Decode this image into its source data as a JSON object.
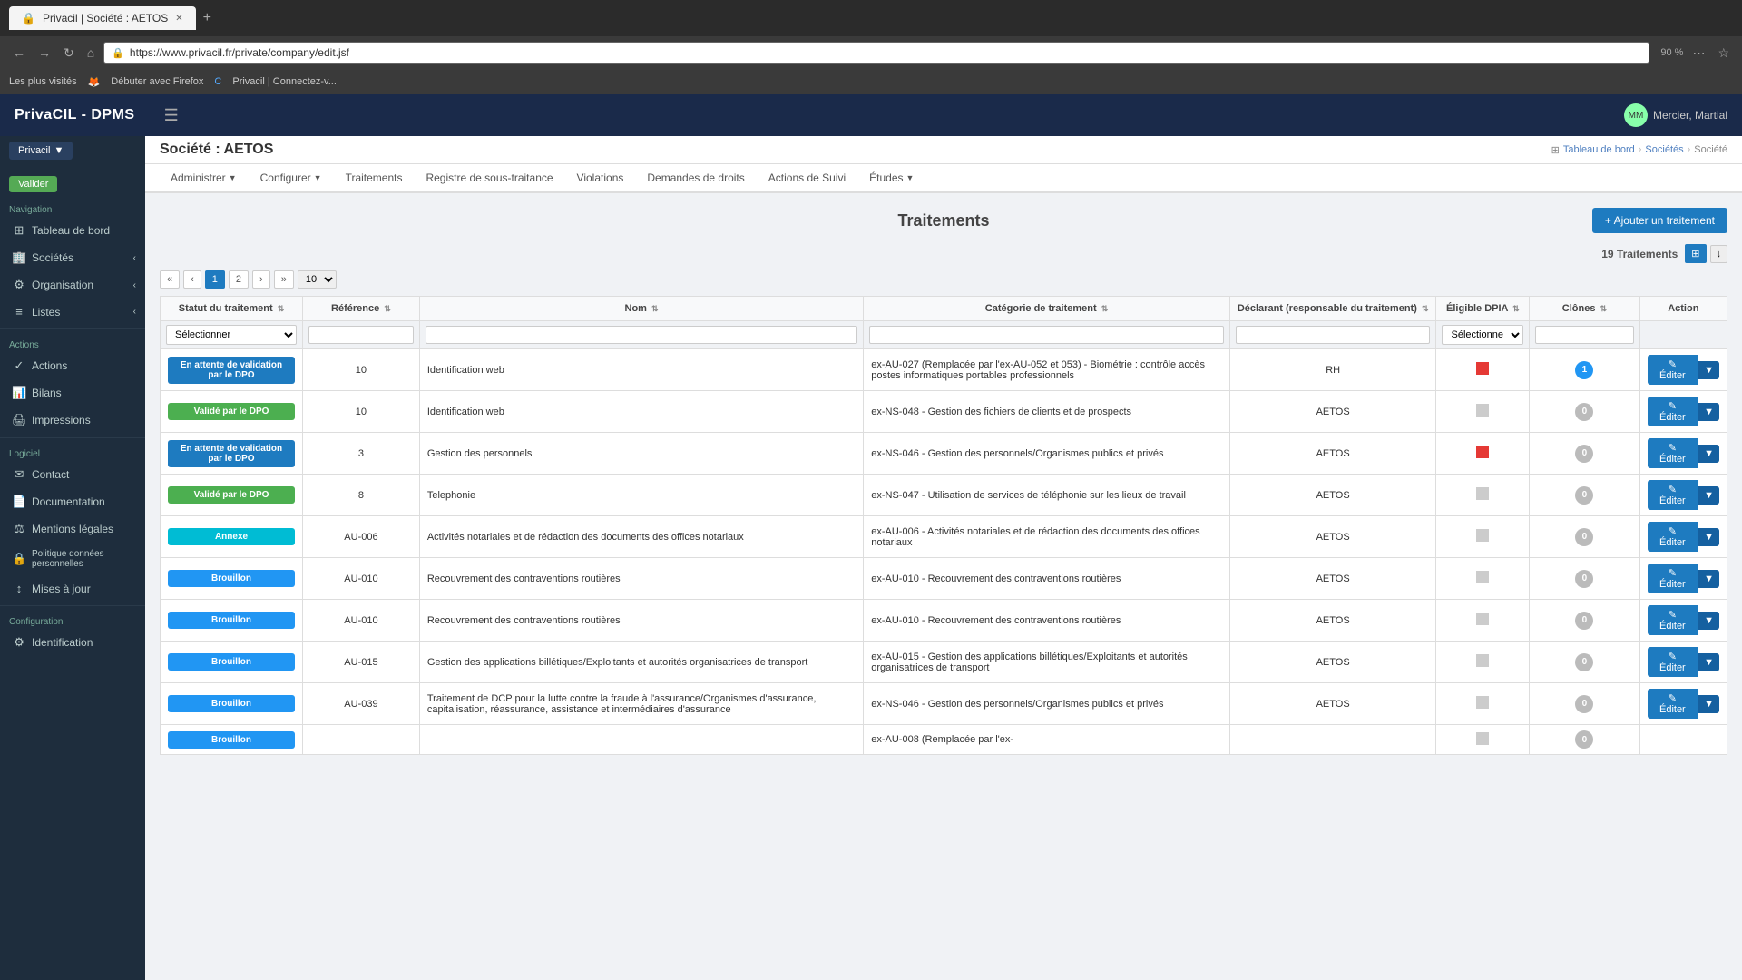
{
  "browser": {
    "tab_title": "Privacil | Société : AETOS",
    "url": "https://www.privacil.fr/private/company/edit.jsf",
    "zoom": "90 %",
    "bookmarks": [
      "Les plus visités",
      "Débuter avec Firefox",
      "Privacil | Connectez-v..."
    ]
  },
  "app": {
    "logo": "PrivaCIL - DPMS",
    "user": "Mercier, Martial"
  },
  "sidebar": {
    "brand": "Privacil",
    "validate_label": "Valider",
    "sections": [
      {
        "label": "Navigation",
        "items": [
          {
            "icon": "🏠",
            "label": "Tableau de bord",
            "arrow": false
          },
          {
            "icon": "🏢",
            "label": "Sociétés",
            "arrow": true
          },
          {
            "icon": "🔧",
            "label": "Organisation",
            "arrow": true
          },
          {
            "icon": "📋",
            "label": "Listes",
            "arrow": true
          }
        ]
      },
      {
        "label": "Actions",
        "items": [
          {
            "icon": "✓",
            "label": "Actions",
            "arrow": false
          },
          {
            "icon": "📊",
            "label": "Bilans",
            "arrow": false
          },
          {
            "icon": "🖨",
            "label": "Impressions",
            "arrow": false
          }
        ]
      },
      {
        "label": "Logiciel",
        "items": [
          {
            "icon": "✉",
            "label": "Contact",
            "arrow": false
          },
          {
            "icon": "📄",
            "label": "Documentation",
            "arrow": false
          },
          {
            "icon": "⚖",
            "label": "Mentions légales",
            "arrow": false
          },
          {
            "icon": "🔒",
            "label": "Politique données personnelles",
            "arrow": false
          },
          {
            "icon": "🔄",
            "label": "Mises à jour",
            "arrow": false
          }
        ]
      },
      {
        "label": "Configuration",
        "items": [
          {
            "icon": "🔑",
            "label": "Identification",
            "arrow": false
          }
        ]
      }
    ]
  },
  "page": {
    "title": "Société : AETOS",
    "breadcrumbs": [
      "Tableau de bord",
      "Sociétés",
      "Société"
    ],
    "content_title": "Traitements",
    "add_button": "+ Ajouter un traitement",
    "count": "19 Traitements"
  },
  "nav_tabs": [
    {
      "label": "Administrer",
      "dropdown": true
    },
    {
      "label": "Configurer",
      "dropdown": true
    },
    {
      "label": "Traitements",
      "dropdown": false
    },
    {
      "label": "Registre de sous-traitance",
      "dropdown": false
    },
    {
      "label": "Violations",
      "dropdown": false
    },
    {
      "label": "Demandes de droits",
      "dropdown": false
    },
    {
      "label": "Actions de Suivi",
      "dropdown": false
    },
    {
      "label": "Études",
      "dropdown": true
    }
  ],
  "pagination": {
    "pages": [
      "«",
      "‹",
      "1",
      "2",
      "»",
      "»»"
    ],
    "current_page": "1",
    "per_page": "10"
  },
  "table": {
    "columns": [
      {
        "label": "Statut du traitement",
        "sortable": true
      },
      {
        "label": "Référence",
        "sortable": true
      },
      {
        "label": "Nom",
        "sortable": true
      },
      {
        "label": "Catégorie de traitement",
        "sortable": true
      },
      {
        "label": "Déclarant (responsable du traitement)",
        "sortable": true
      },
      {
        "label": "Éligible DPIA",
        "sortable": true
      },
      {
        "label": "Clônes",
        "sortable": true
      },
      {
        "label": "Action",
        "sortable": false
      }
    ],
    "filters": {
      "statut": "Sélectionner",
      "reference": "",
      "nom": "",
      "categorie": "",
      "declarant": "",
      "eligible": "Sélectionner",
      "clones": ""
    },
    "rows": [
      {
        "status": "En attente de validation par le DPO",
        "status_type": "pending",
        "reference": "10",
        "nom": "Identification web",
        "categorie": "ex-AU-027 (Remplacée par l'ex-AU-052 et 053) - Biométrie : contrôle accès postes informatiques portables professionnels",
        "declarant": "RH",
        "eligible": "red",
        "clones": "1",
        "clones_type": "blue"
      },
      {
        "status": "Validé par le DPO",
        "status_type": "validated",
        "reference": "10",
        "nom": "Identification web",
        "categorie": "ex-NS-048 - Gestion des fichiers de clients et de prospects",
        "declarant": "AETOS",
        "eligible": "gray",
        "clones": "0",
        "clones_type": "gray"
      },
      {
        "status": "En attente de validation par le DPO",
        "status_type": "pending",
        "reference": "3",
        "nom": "Gestion des personnels",
        "categorie": "ex-NS-046 - Gestion des personnels/Organismes publics et privés",
        "declarant": "AETOS",
        "eligible": "red",
        "clones": "0",
        "clones_type": "gray"
      },
      {
        "status": "Validé par le DPO",
        "status_type": "validated",
        "reference": "8",
        "nom": "Telephonie",
        "categorie": "ex-NS-047 - Utilisation de services de téléphonie sur les lieux de travail",
        "declarant": "AETOS",
        "eligible": "gray",
        "clones": "0",
        "clones_type": "gray"
      },
      {
        "status": "Annexe",
        "status_type": "annex",
        "reference": "AU-006",
        "nom": "Activités notariales et de rédaction des documents des offices notariaux",
        "categorie": "ex-AU-006 - Activités notariales et de rédaction des documents des offices notariaux",
        "declarant": "AETOS",
        "eligible": "gray",
        "clones": "0",
        "clones_type": "gray"
      },
      {
        "status": "Brouillon",
        "status_type": "draft",
        "reference": "AU-010",
        "nom": "Recouvrement des contraventions routières",
        "categorie": "ex-AU-010 - Recouvrement des contraventions routières",
        "declarant": "AETOS",
        "eligible": "gray",
        "clones": "0",
        "clones_type": "gray"
      },
      {
        "status": "Brouillon",
        "status_type": "draft",
        "reference": "AU-010",
        "nom": "Recouvrement des contraventions routières",
        "categorie": "ex-AU-010 - Recouvrement des contraventions routières",
        "declarant": "AETOS",
        "eligible": "gray",
        "clones": "0",
        "clones_type": "gray"
      },
      {
        "status": "Brouillon",
        "status_type": "draft",
        "reference": "AU-015",
        "nom": "Gestion des applications billétiques/Exploitants et autorités organisatrices de transport",
        "categorie": "ex-AU-015 - Gestion des applications billétiques/Exploitants et autorités organisatrices de transport",
        "declarant": "AETOS",
        "eligible": "gray",
        "clones": "0",
        "clones_type": "gray"
      },
      {
        "status": "Brouillon",
        "status_type": "draft",
        "reference": "AU-039",
        "nom": "Traitement de DCP pour la lutte contre la fraude à l'assurance/Organismes d'assurance, capitalisation, réassurance, assistance et intermédiaires d'assurance",
        "categorie": "ex-NS-046 - Gestion des personnels/Organismes publics et privés",
        "declarant": "AETOS",
        "eligible": "gray",
        "clones": "0",
        "clones_type": "gray"
      },
      {
        "status": "Brouillon",
        "status_type": "draft",
        "reference": "",
        "nom": "",
        "categorie": "ex-AU-008 (Remplacée par l'ex-",
        "declarant": "",
        "eligible": "gray",
        "clones": "0",
        "clones_type": "gray"
      }
    ]
  },
  "labels": {
    "edit": "✎ Éditer",
    "edit_short": "Éditer"
  }
}
